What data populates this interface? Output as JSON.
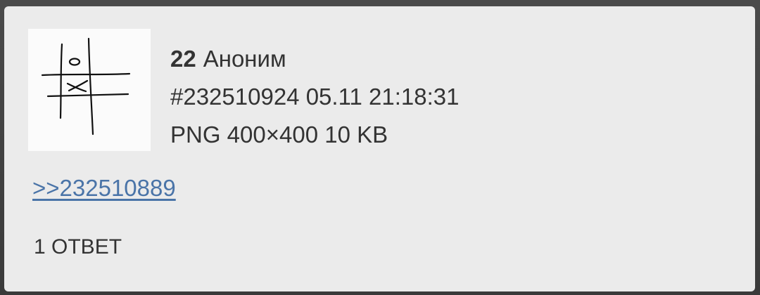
{
  "post": {
    "number": "22",
    "author": "Аноним",
    "id_datetime": "#232510924 05.11 21:18:31",
    "file_info": "PNG 400×400 10 KB",
    "thumbnail_icon": "tic-tac-toe-sketch",
    "reply_link": ">>232510889",
    "replies_label": "1 ОТВЕТ"
  },
  "colors": {
    "card_background": "#ebebeb",
    "text": "#333333",
    "link": "#4a74a8",
    "backdrop": "#3a3a3a"
  }
}
